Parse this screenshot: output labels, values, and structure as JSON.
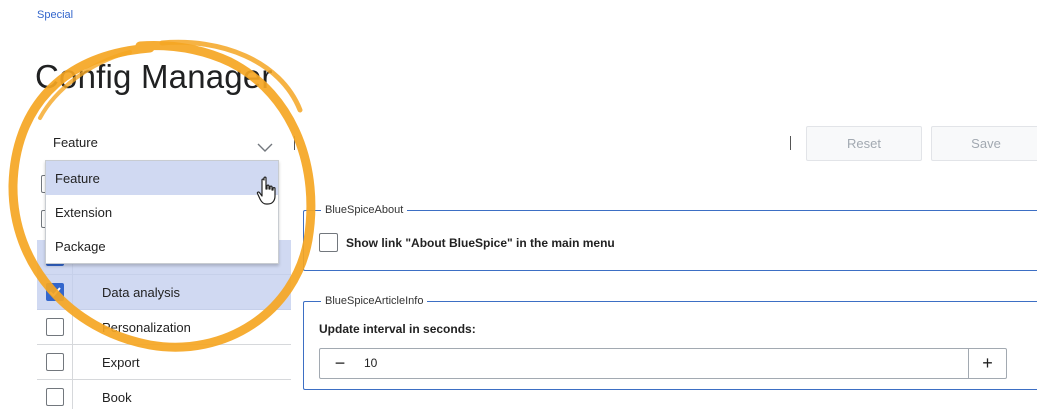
{
  "breadcrumb": "Special",
  "page_title": "Config Manager",
  "grouping_select": {
    "value": "Feature"
  },
  "dropdown": {
    "options": [
      {
        "label": "Feature"
      },
      {
        "label": "Extension"
      },
      {
        "label": "Package"
      }
    ],
    "highlighted": "Feature"
  },
  "toolbar": {
    "reset_label": "Reset",
    "save_label": "Save"
  },
  "features": [
    {
      "label": "Data analysis",
      "checked": true
    },
    {
      "label": "Personalization",
      "checked": false
    },
    {
      "label": "Export",
      "checked": false
    },
    {
      "label": "Book",
      "checked": false
    }
  ],
  "settings": {
    "about": {
      "legend": "BlueSpiceAbout",
      "checkbox_label": "Show link \"About BlueSpice\" in the main menu"
    },
    "article_info": {
      "legend": "BlueSpiceArticleInfo",
      "field_label": "Update interval in seconds:",
      "value": "10",
      "minus": "−",
      "plus": "+"
    }
  },
  "colors": {
    "accent": "#3366cc",
    "selection": "#d0d9f2",
    "highlight_ring": "#f5a623"
  }
}
